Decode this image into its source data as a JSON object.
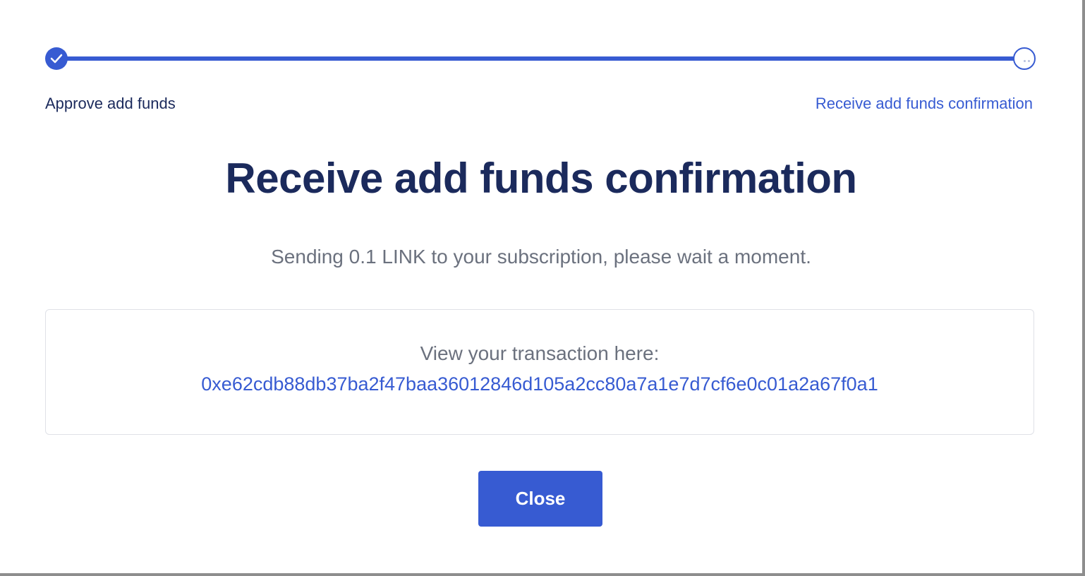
{
  "stepper": {
    "steps": [
      {
        "label": "Approve add funds",
        "status": "complete"
      },
      {
        "label": "Receive add funds confirmation",
        "status": "pending"
      }
    ]
  },
  "main": {
    "title": "Receive add funds confirmation",
    "subtitle": "Sending 0.1 LINK to your subscription, please wait a moment."
  },
  "transaction": {
    "label": "View your transaction here:",
    "hash": "0xe62cdb88db37ba2f47baa36012846d105a2cc80a7a1e7d7cf6e0c01a2a67f0a1"
  },
  "actions": {
    "close_label": "Close"
  },
  "colors": {
    "accent": "#375bd2",
    "heading": "#1b2a5c",
    "muted": "#6b717e"
  }
}
